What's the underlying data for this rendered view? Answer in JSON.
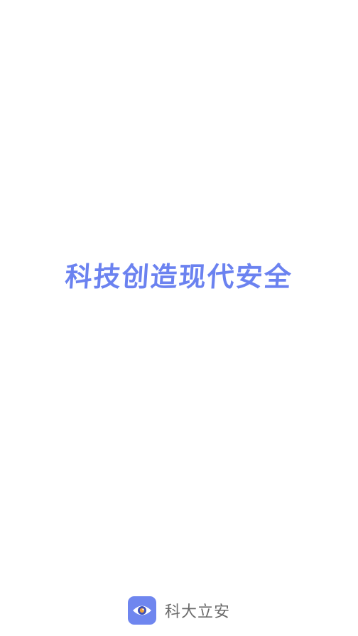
{
  "splash": {
    "slogan": "科技创造现代安全",
    "accent_color": "#6b82f0"
  },
  "brand": {
    "icon": "eye-logo-icon",
    "name": "科大立安"
  }
}
